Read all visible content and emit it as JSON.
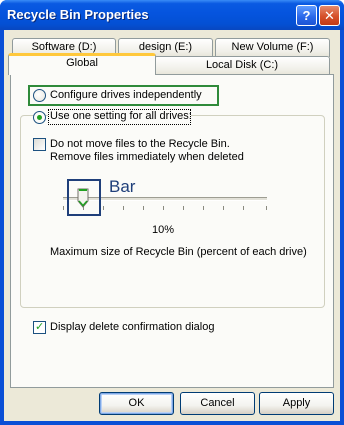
{
  "window": {
    "title": "Recycle Bin Properties",
    "help_glyph": "?",
    "close_glyph": "✕"
  },
  "tabs": {
    "row1": [
      "Software (D:)",
      "design (E:)",
      "New Volume (F:)"
    ],
    "row2": [
      "Global",
      "Local Disk (C:)"
    ],
    "active": "Global"
  },
  "options": {
    "configure_independently": {
      "label": "Configure drives independently",
      "selected": false
    },
    "use_one_setting": {
      "label": "Use one setting for all drives:",
      "selected": true
    }
  },
  "do_not_move": {
    "line1": "Do not move files to the Recycle Bin.",
    "line2": "Remove files immediately when deleted",
    "checked": false
  },
  "slider": {
    "annotation": "Bar",
    "value_text": "10%",
    "value_percent": 10,
    "caption": "Maximum size of Recycle Bin (percent of each drive)"
  },
  "display_confirmation": {
    "label": "Display delete confirmation dialog",
    "checked": true
  },
  "buttons": {
    "ok": "OK",
    "cancel": "Cancel",
    "apply": "Apply"
  },
  "colors": {
    "title_bar": "#0554de",
    "dialog_bg": "#ece9d8",
    "active_tab_accent": "#ffc83c",
    "highlight_box": "#2f8a3a",
    "annotation_box": "#1f3f7a"
  }
}
